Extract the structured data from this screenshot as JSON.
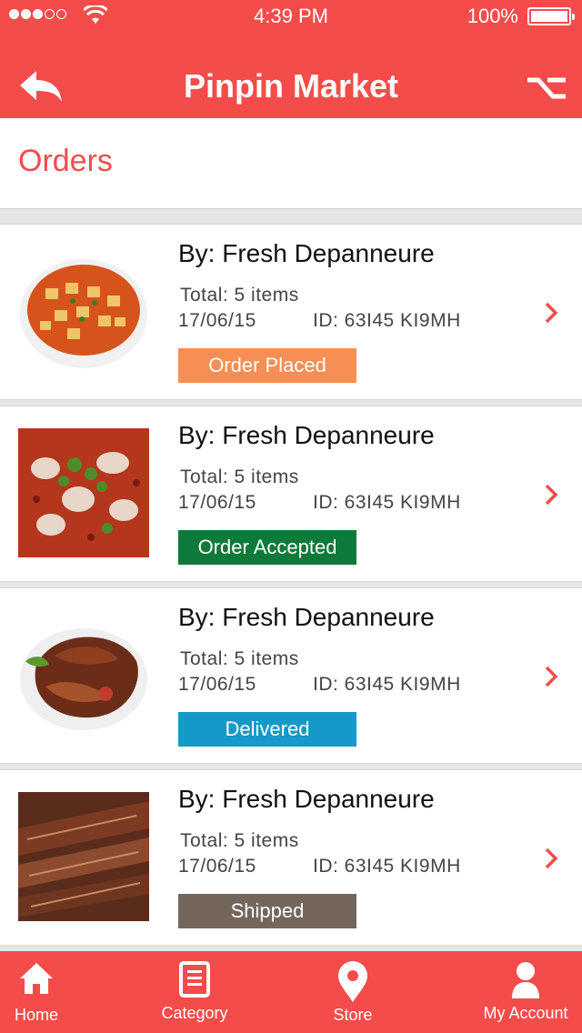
{
  "status_bar": {
    "time": "4:39 PM",
    "battery": "100%"
  },
  "header": {
    "title": "Pinpin Market"
  },
  "section": {
    "title": "Orders"
  },
  "orders": [
    {
      "store": "By: Fresh Depanneure",
      "total": "Total: 5 items",
      "date": "17/06/15",
      "id": "ID: 63I45 KI9MH",
      "status": "Order Placed",
      "status_color": "#f78e54",
      "dish": "mapo-tofu"
    },
    {
      "store": "By: Fresh Depanneure",
      "total": "Total: 5 items",
      "date": "17/06/15",
      "id": "ID: 63I45 KI9MH",
      "status": "Order Accepted",
      "status_color": "#0e7a3a",
      "dish": "spicy-fish"
    },
    {
      "store": "By: Fresh Depanneure",
      "total": "Total: 5 items",
      "date": "17/06/15",
      "id": "ID: 63I45 KI9MH",
      "status": "Delivered",
      "status_color": "#1599c8",
      "dish": "roast-duck"
    },
    {
      "store": "By: Fresh Depanneure",
      "total": "Total: 5 items",
      "date": "17/06/15",
      "id": "ID: 63I45 KI9MH",
      "status": "Shipped",
      "status_color": "#75665c",
      "dish": "braised-meat"
    }
  ],
  "tabs": [
    {
      "label": "Home",
      "icon": "home-icon"
    },
    {
      "label": "Category",
      "icon": "document-icon"
    },
    {
      "label": "Store",
      "icon": "location-pin-icon"
    },
    {
      "label": "My Account",
      "icon": "user-icon"
    }
  ],
  "colors": {
    "accent": "#f44c4a"
  }
}
